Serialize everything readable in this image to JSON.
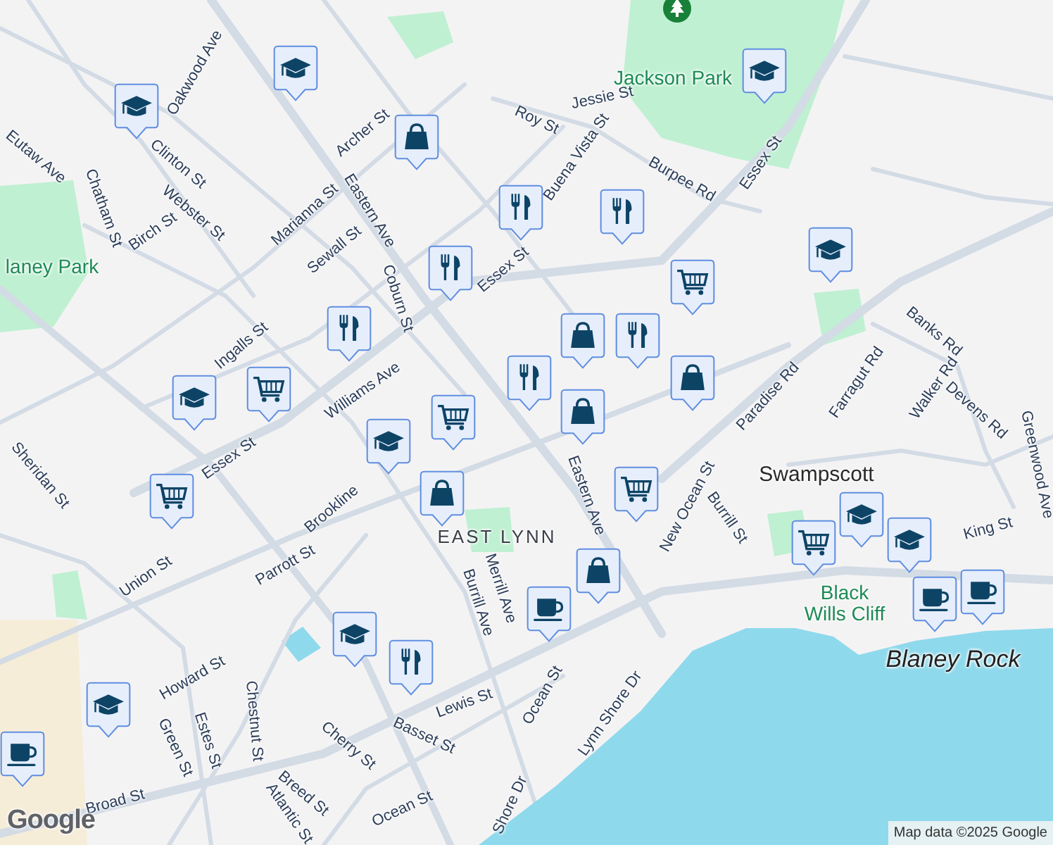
{
  "map": {
    "labels": [
      {
        "text": "Oakwood Ave",
        "kind": "street"
      },
      {
        "text": "Clinton St",
        "kind": "street"
      },
      {
        "text": "Eutaw Ave",
        "kind": "street"
      },
      {
        "text": "Chatham St",
        "kind": "street"
      },
      {
        "text": "Webster St",
        "kind": "street"
      },
      {
        "text": "Birch St",
        "kind": "street"
      },
      {
        "text": "laney Park",
        "kind": "park"
      },
      {
        "text": "Marianna St",
        "kind": "street"
      },
      {
        "text": "Sewall St",
        "kind": "street"
      },
      {
        "text": "Ingalls St",
        "kind": "street"
      },
      {
        "text": "Archer St",
        "kind": "street"
      },
      {
        "text": "Eastern Ave",
        "kind": "street"
      },
      {
        "text": "Coburn St",
        "kind": "street"
      },
      {
        "text": "Jackson Park",
        "kind": "park"
      },
      {
        "text": "Roy St",
        "kind": "street"
      },
      {
        "text": "Jessie St",
        "kind": "street"
      },
      {
        "text": "Buena Vista St",
        "kind": "street"
      },
      {
        "text": "Burpee Rd",
        "kind": "street"
      },
      {
        "text": "Essex St",
        "kind": "street"
      },
      {
        "text": "Essex St",
        "kind": "street"
      },
      {
        "text": "Paradise Rd",
        "kind": "street"
      },
      {
        "text": "Banks Rd",
        "kind": "street"
      },
      {
        "text": "Farragut Rd",
        "kind": "street"
      },
      {
        "text": "Walker Rd",
        "kind": "street"
      },
      {
        "text": "Devens Rd",
        "kind": "street"
      },
      {
        "text": "Greenwood Ave",
        "kind": "street"
      },
      {
        "text": "Swampscott",
        "kind": "town"
      },
      {
        "text": "Burrill St",
        "kind": "street"
      },
      {
        "text": "King St",
        "kind": "street"
      },
      {
        "text": "Black Wills Cliff",
        "kind": "park"
      },
      {
        "text": "Blaney Rock",
        "kind": "feature"
      },
      {
        "text": "Williams Ave",
        "kind": "street"
      },
      {
        "text": "Sheridan St",
        "kind": "street"
      },
      {
        "text": "Essex St",
        "kind": "street"
      },
      {
        "text": "Union St",
        "kind": "street"
      },
      {
        "text": "Parrott St",
        "kind": "street"
      },
      {
        "text": "Brookline",
        "kind": "street"
      },
      {
        "text": "EAST LYNN",
        "kind": "district"
      },
      {
        "text": "Merrill Ave",
        "kind": "street"
      },
      {
        "text": "Burrill Ave",
        "kind": "street"
      },
      {
        "text": "Eastern Ave",
        "kind": "street"
      },
      {
        "text": "New Ocean St",
        "kind": "street"
      },
      {
        "text": "Ocean St",
        "kind": "street"
      },
      {
        "text": "Lynn Shore Dr",
        "kind": "street"
      },
      {
        "text": "Shore Dr",
        "kind": "street"
      },
      {
        "text": "Lewis St",
        "kind": "street"
      },
      {
        "text": "Basset St",
        "kind": "street"
      },
      {
        "text": "Ocean St",
        "kind": "street"
      },
      {
        "text": "Howard St",
        "kind": "street"
      },
      {
        "text": "Green St",
        "kind": "street"
      },
      {
        "text": "Estes St",
        "kind": "street"
      },
      {
        "text": "Chestnut St",
        "kind": "street"
      },
      {
        "text": "Cherry St",
        "kind": "street"
      },
      {
        "text": "Breed St",
        "kind": "street"
      },
      {
        "text": "Atlantic St",
        "kind": "street"
      },
      {
        "text": "Broad St",
        "kind": "street"
      }
    ],
    "markers": [
      {
        "kind": "school"
      },
      {
        "kind": "school"
      },
      {
        "kind": "school"
      },
      {
        "kind": "school"
      },
      {
        "kind": "bag"
      },
      {
        "kind": "food"
      },
      {
        "kind": "food"
      },
      {
        "kind": "food"
      },
      {
        "kind": "food"
      },
      {
        "kind": "cart"
      },
      {
        "kind": "school"
      },
      {
        "kind": "cart"
      },
      {
        "kind": "bag"
      },
      {
        "kind": "food"
      },
      {
        "kind": "food"
      },
      {
        "kind": "bag"
      },
      {
        "kind": "bag"
      },
      {
        "kind": "cart"
      },
      {
        "kind": "school"
      },
      {
        "kind": "bag"
      },
      {
        "kind": "cart"
      },
      {
        "kind": "cart"
      },
      {
        "kind": "bag"
      },
      {
        "kind": "coffee"
      },
      {
        "kind": "school"
      },
      {
        "kind": "food"
      },
      {
        "kind": "school"
      },
      {
        "kind": "school"
      },
      {
        "kind": "cart"
      },
      {
        "kind": "school"
      },
      {
        "kind": "coffee"
      },
      {
        "kind": "coffee"
      },
      {
        "kind": "coffee"
      }
    ],
    "attribution": "Map data ©2025 Google",
    "logo": "Google"
  }
}
